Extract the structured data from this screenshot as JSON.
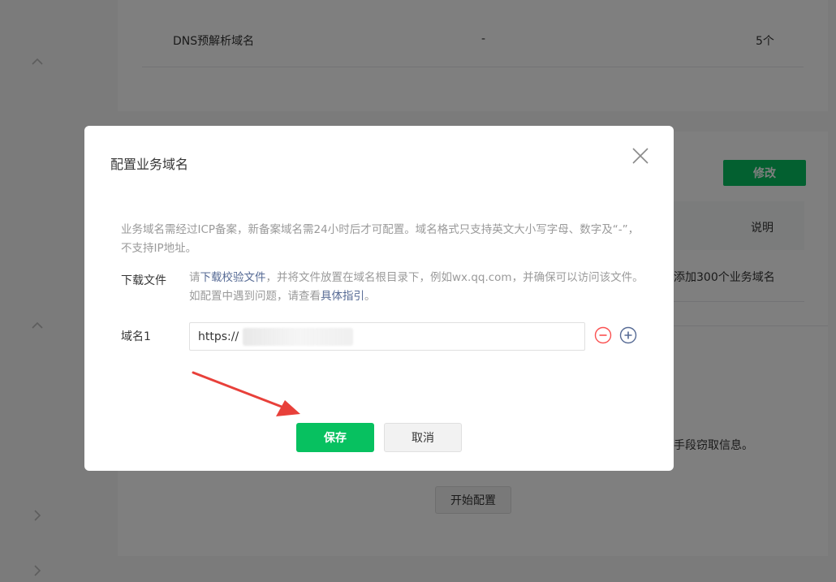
{
  "background": {
    "dns_row": {
      "name": "DNS预解析域名",
      "value": "-",
      "count": "5个"
    },
    "modify_label": "修改",
    "table_header_note": "说明",
    "row_text_partial": "添加300个业务域名",
    "warning_text_partial": "手段窃取信息。",
    "start_config_label": "开始配置"
  },
  "modal": {
    "title": "配置业务域名",
    "notice": "业务域名需经过ICP备案，新备案域名需24小时后才可配置。域名格式只支持英文大小写字母、数字及“-”，不支持IP地址。",
    "download": {
      "label": "下载文件",
      "prefix": "请",
      "link_file": "下载校验文件",
      "middle": "，并将文件放置在域名根目录下，例如wx.qq.com，并确保可以访问该文件。如配置中遇到问题，请查看",
      "link_guide": "具体指引",
      "suffix": "。"
    },
    "domain": {
      "label": "域名1",
      "value": "https://"
    },
    "save_label": "保存",
    "cancel_label": "取消"
  },
  "colors": {
    "primary_green": "#07c160",
    "link_blue": "#576b95",
    "danger_red": "#fa5151",
    "annotation_red": "#e8403a"
  },
  "icons": {
    "close": "close-icon",
    "remove": "minus-circle-icon",
    "add": "plus-circle-icon",
    "nav": "chevron-icon"
  }
}
